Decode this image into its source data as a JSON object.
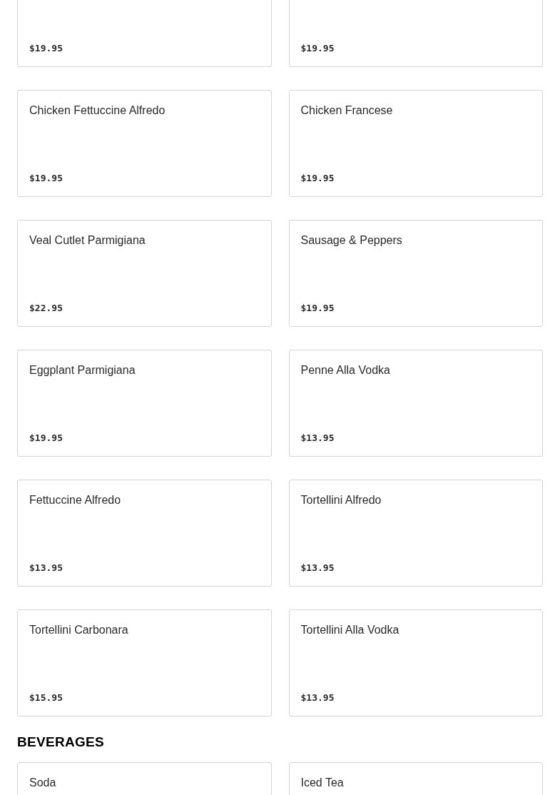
{
  "sections": [
    {
      "items": [
        {
          "price": "$19.95"
        },
        {
          "price": "$19.95"
        },
        {
          "name": "Chicken Fettuccine Alfredo",
          "price": "$19.95"
        },
        {
          "name": "Chicken Francese",
          "price": "$19.95"
        },
        {
          "name": "Veal Cutlet Parmigiana",
          "price": "$22.95"
        },
        {
          "name": "Sausage & Peppers",
          "price": "$19.95"
        },
        {
          "name": "Eggplant Parmigiana",
          "price": "$19.95"
        },
        {
          "name": "Penne Alla Vodka",
          "price": "$13.95"
        },
        {
          "name": "Fettuccine Alfredo",
          "price": "$13.95"
        },
        {
          "name": "Tortellini Alfredo",
          "price": "$13.95"
        },
        {
          "name": "Tortellini Carbonara",
          "price": "$15.95"
        },
        {
          "name": "Tortellini Alla Vodka",
          "price": "$13.95"
        }
      ]
    },
    {
      "title": "BEVERAGES",
      "items": [
        {
          "name": "Soda"
        },
        {
          "name": "Iced Tea"
        }
      ]
    }
  ]
}
